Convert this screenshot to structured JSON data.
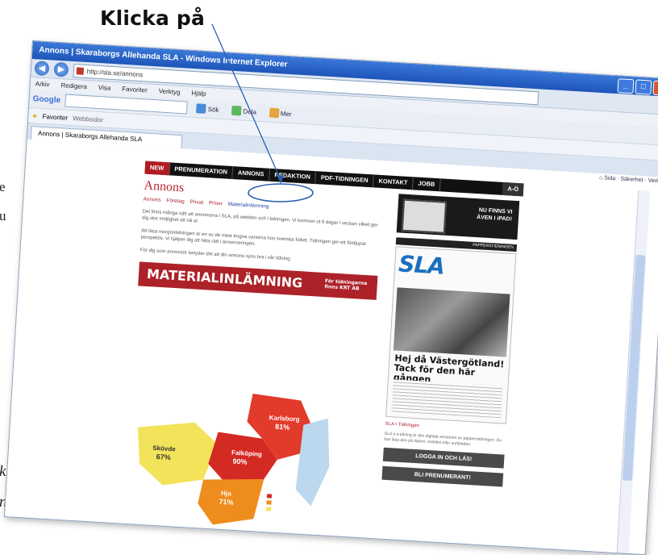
{
  "caption": {
    "text": "Klicka på"
  },
  "left_fragments": [
    "e",
    "u"
  ],
  "bottom_fragments": [
    "kt",
    "ntet."
  ],
  "browser": {
    "title": "Annons | Skaraborgs Allehanda SLA - Windows Internet Explorer",
    "address": "http://sla.se/annons",
    "menu": [
      "Arkiv",
      "Redigera",
      "Visa",
      "Favoriter",
      "Verktyg",
      "Hjälp"
    ],
    "google_label": "Google",
    "google_buttons": [
      "Sök",
      "Dela",
      "Mer"
    ],
    "favorites_label": "Favoriter",
    "favorites_items": [
      "Webbsidor"
    ],
    "tab_label": "Annons | Skaraborgs Allehanda SLA",
    "command_bar": [
      "Sida",
      "Säkerhet",
      "Verktyg"
    ]
  },
  "site": {
    "nav": [
      "NEW",
      "PRENUMERATION",
      "ANNONS",
      "REDAKTION",
      "PDF-TIDNINGEN",
      "KONTAKT",
      "JOBB",
      "A-Ö"
    ],
    "headline": "Annons",
    "breadcrumbs": [
      "Annons",
      "Företag",
      "Privat",
      "Priser",
      "Materialinlämning"
    ],
    "paragraphs": [
      "Det finns många sätt att annonsera i SLA, på webben och i tidningen. Vi kommer ut 6 dagar i veckan vilket ger dig stor möjlighet att nå ut.",
      "Att läsa morgontidningen är en av de mest trogna vanorna hos svenska folket. Tidningen ger ett fördjupat perspektiv. Vi hjälper dig att hitta rätt i annonseringen.",
      "För dig som annonsör betyder det att din annons syns bra i vår tidning."
    ],
    "material_title": "MATERIALINLÄMNING",
    "material_sub": "För tidningarna finns KRT AB",
    "map_regions": [
      {
        "name": "Karlsborg",
        "pct": "81%"
      },
      {
        "name": "Skövde",
        "pct": "67%"
      },
      {
        "name": "Falköping",
        "pct": "90%"
      },
      {
        "name": "Hjo",
        "pct": "71%"
      }
    ],
    "side_ad": {
      "line1": "NU FINNS VI",
      "line2": "ÄVEN I iPAD!"
    },
    "archive_label": "PAPPERSTIDNINGEN",
    "paper": {
      "masthead": "SLA",
      "headline": "Hej då Västergötland! Tack för den här gången"
    },
    "side_link": "SLA • Tidningen",
    "side_text": "SLA:s e-tidning är den digitala versionen av papperstidningen. Du kan läsa den på datorn, mobilen eller surfplattan.",
    "buttons": [
      "LOGGA IN OCH LÄS!",
      "BLI PRENUMERANT!"
    ]
  }
}
